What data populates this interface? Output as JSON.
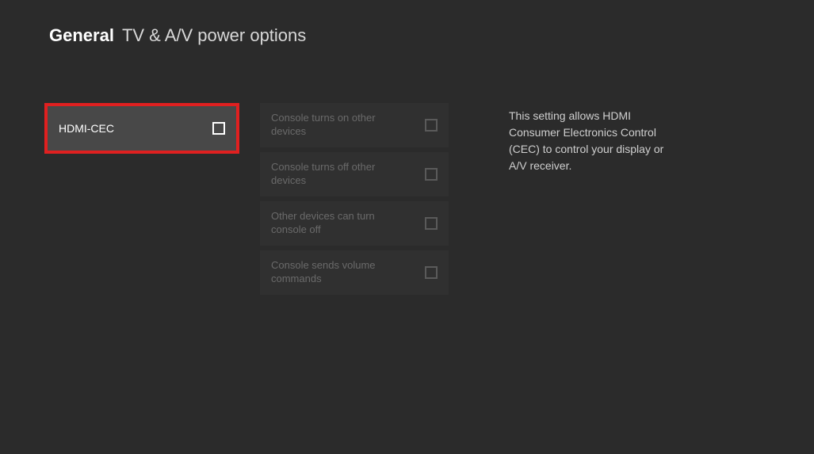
{
  "header": {
    "section": "General",
    "page": "TV & A/V power options"
  },
  "primary_option": {
    "label": "HDMI-CEC",
    "checked": false
  },
  "secondary_options": [
    {
      "label": "Console turns on other devices",
      "checked": false
    },
    {
      "label": "Console turns off other devices",
      "checked": false
    },
    {
      "label": "Other devices can turn console off",
      "checked": false
    },
    {
      "label": "Console sends volume commands",
      "checked": false
    }
  ],
  "description": "This setting allows HDMI Consumer Electronics Control (CEC) to control your display or A/V receiver."
}
